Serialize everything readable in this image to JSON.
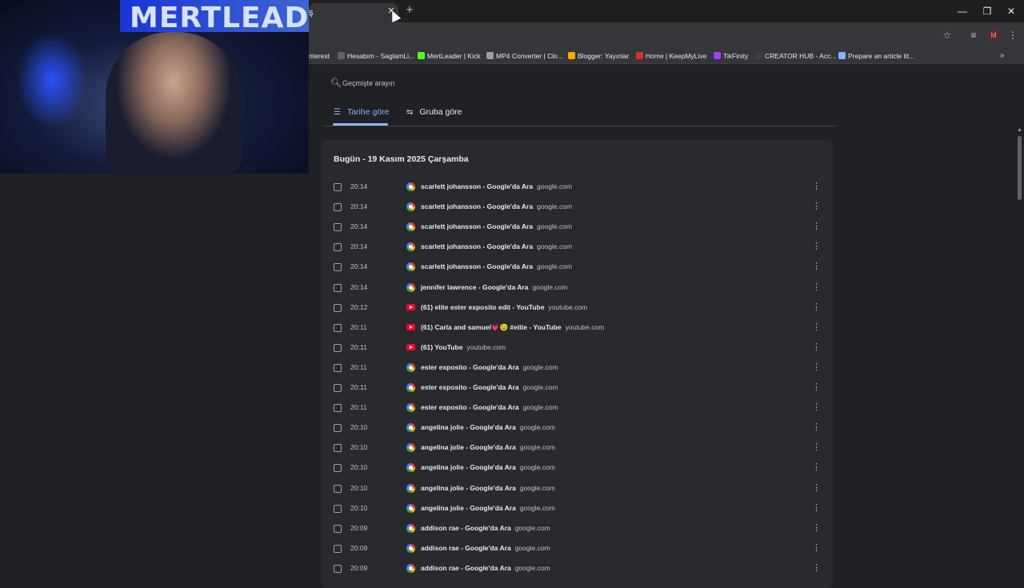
{
  "tab": {
    "title": "ş"
  },
  "window": {
    "minimize": "—",
    "maximize": "❐",
    "close": "✕"
  },
  "bookmarks": [
    {
      "label": "nterest",
      "color": "#35363a"
    },
    {
      "label": "Hesabım - SaglamLi...",
      "color": "#5f6368"
    },
    {
      "label": "MertLeader | Kick",
      "color": "#53fc18"
    },
    {
      "label": "MP4 Converter | Clo...",
      "color": "#9aa0a6"
    },
    {
      "label": "Blogger: Yayınlar",
      "color": "#f9ab00"
    },
    {
      "label": "Home | KeepMyLive",
      "color": "#d93025"
    },
    {
      "label": "TikFinity",
      "color": "#a142f4"
    },
    {
      "label": "CREATOR HUB - Acc...",
      "color": "#3c4043"
    },
    {
      "label": "Prepare an article tit...",
      "color": "#8ab4f8"
    }
  ],
  "webcam": {
    "brand": "MERTLEAD"
  },
  "avatar": "M",
  "search": {
    "placeholder": "Geçmişte arayın"
  },
  "view_tabs": [
    {
      "label": "Tarihe göre",
      "active": true
    },
    {
      "label": "Gruba göre",
      "active": false
    }
  ],
  "history": {
    "date_header": "Bugün - 19 Kasım 2025 Çarşamba",
    "entries": [
      {
        "time": "20:14",
        "title": "scarlett johansson - Google'da Ara",
        "domain": "google.com",
        "icon": "google"
      },
      {
        "time": "20:14",
        "title": "scarlett johansson - Google'da Ara",
        "domain": "google.com",
        "icon": "google"
      },
      {
        "time": "20:14",
        "title": "scarlett johansson - Google'da Ara",
        "domain": "google.com",
        "icon": "google"
      },
      {
        "time": "20:14",
        "title": "scarlett johansson - Google'da Ara",
        "domain": "google.com",
        "icon": "google"
      },
      {
        "time": "20:14",
        "title": "scarlett johansson - Google'da Ara",
        "domain": "google.com",
        "icon": "google"
      },
      {
        "time": "20:14",
        "title": "jennifer lawrence - Google'da Ara",
        "domain": "google.com",
        "icon": "google"
      },
      {
        "time": "20:12",
        "title": "(61) elite ester exposito edit - YouTube",
        "domain": "youtube.com",
        "icon": "youtube"
      },
      {
        "time": "20:11",
        "title": "(61) Carla and samuel💗😉 #elite - YouTube",
        "domain": "youtube.com",
        "icon": "youtube"
      },
      {
        "time": "20:11",
        "title": "(61) YouTube",
        "domain": "youtube.com",
        "icon": "youtube"
      },
      {
        "time": "20:11",
        "title": "ester exposito - Google'da Ara",
        "domain": "google.com",
        "icon": "google"
      },
      {
        "time": "20:11",
        "title": "ester exposito - Google'da Ara",
        "domain": "google.com",
        "icon": "google"
      },
      {
        "time": "20:11",
        "title": "ester exposito - Google'da Ara",
        "domain": "google.com",
        "icon": "google"
      },
      {
        "time": "20:10",
        "title": "angelina jolie - Google'da Ara",
        "domain": "google.com",
        "icon": "google"
      },
      {
        "time": "20:10",
        "title": "angelina jolie - Google'da Ara",
        "domain": "google.com",
        "icon": "google"
      },
      {
        "time": "20:10",
        "title": "angelina jolie - Google'da Ara",
        "domain": "google.com",
        "icon": "google"
      },
      {
        "time": "20:10",
        "title": "angelina jolie - Google'da Ara",
        "domain": "google.com",
        "icon": "google"
      },
      {
        "time": "20:10",
        "title": "angelina jolie - Google'da Ara",
        "domain": "google.com",
        "icon": "google"
      },
      {
        "time": "20:09",
        "title": "addison rae - Google'da Ara",
        "domain": "google.com",
        "icon": "google"
      },
      {
        "time": "20:09",
        "title": "addison rae - Google'da Ara",
        "domain": "google.com",
        "icon": "google"
      },
      {
        "time": "20:09",
        "title": "addison rae - Google'da Ara",
        "domain": "google.com",
        "icon": "google"
      }
    ]
  }
}
